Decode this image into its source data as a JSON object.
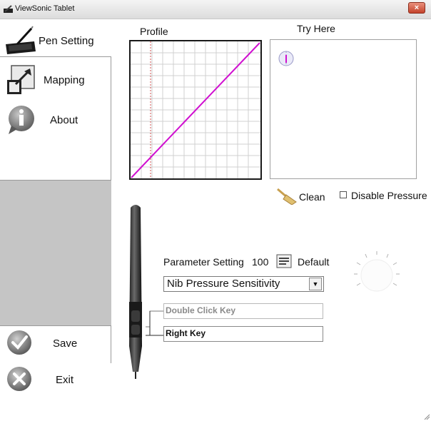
{
  "window": {
    "title": "ViewSonic Tablet",
    "close_label": "×"
  },
  "sidebar": {
    "pen_setting": "Pen Setting",
    "mapping": "Mapping",
    "about": "About",
    "save": "Save",
    "exit": "Exit"
  },
  "profile": {
    "label": "Profile"
  },
  "tryhere": {
    "label": "Try Here"
  },
  "clean": {
    "label": "Clean"
  },
  "disable_pressure": {
    "label": "Disable Pressure",
    "checked": false
  },
  "parameter": {
    "label": "Parameter Setting",
    "value": "100",
    "default_label": "Default"
  },
  "select": {
    "value": "Nib Pressure Sensitivity"
  },
  "keys": {
    "upper": "Double Click Key",
    "lower": "Right Key"
  },
  "colors": {
    "curve": "#d010d0",
    "dotted": "#d05050",
    "gray_panel": "#c5c5c5",
    "close": "#c4432b"
  }
}
